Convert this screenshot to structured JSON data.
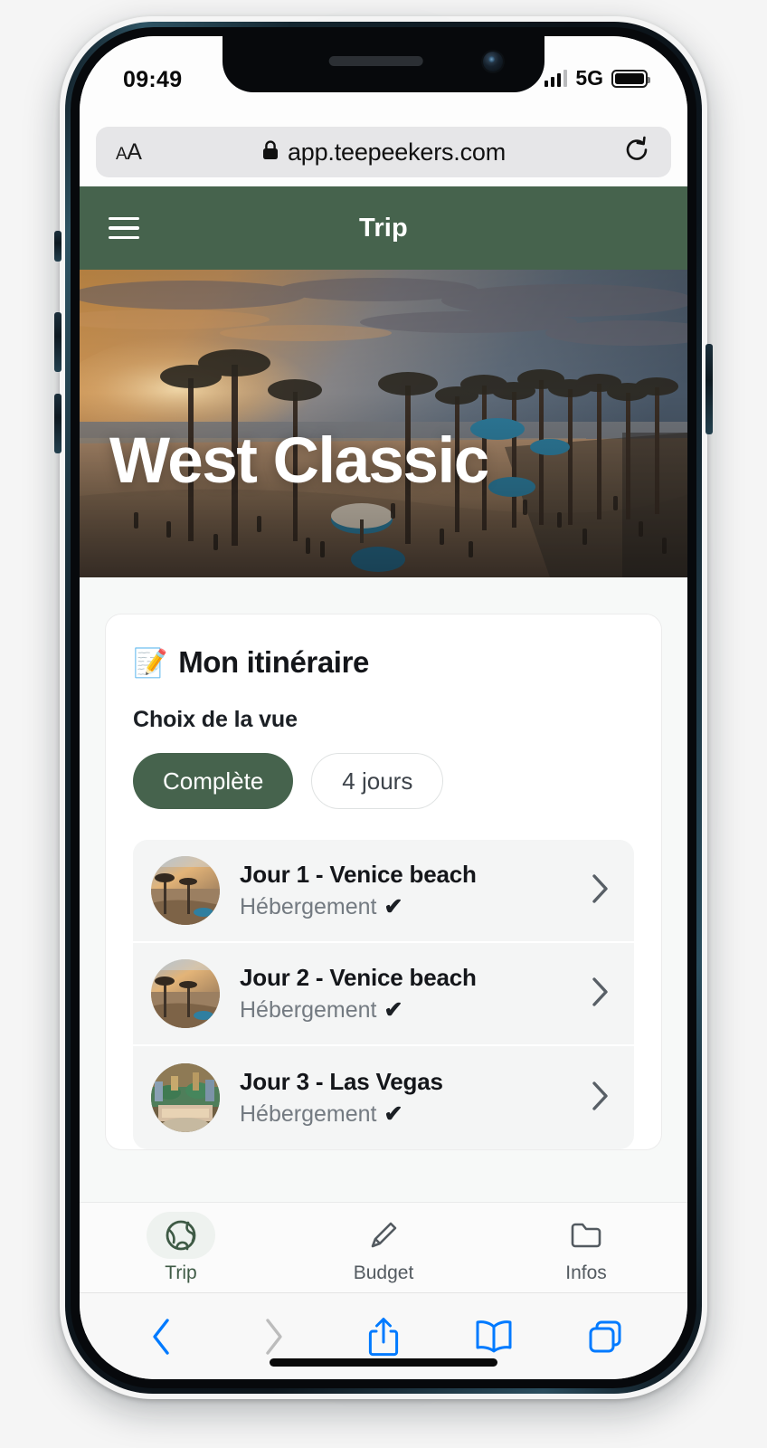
{
  "status_bar": {
    "time": "09:49",
    "network": "5G",
    "signal_icon": "signal-bars-icon",
    "battery_icon": "battery-full-icon"
  },
  "browser": {
    "text_size_button": "AA",
    "lock_icon": "lock-icon",
    "url": "app.teepeekers.com",
    "reload_icon": "reload-icon",
    "toolbar": [
      {
        "name": "back-button",
        "icon": "chevron-left-icon",
        "state": "enabled",
        "color": "#007aff"
      },
      {
        "name": "forward-button",
        "icon": "chevron-right-icon",
        "state": "disabled",
        "color": "#bcbcbc"
      },
      {
        "name": "share-button",
        "icon": "share-icon",
        "state": "enabled",
        "color": "#007aff"
      },
      {
        "name": "bookmarks-button",
        "icon": "book-icon",
        "state": "enabled",
        "color": "#007aff"
      },
      {
        "name": "tabs-button",
        "icon": "tabs-icon",
        "state": "enabled",
        "color": "#007aff"
      }
    ]
  },
  "app_header": {
    "menu_icon": "hamburger-menu-icon",
    "title": "Trip",
    "background_color": "#46634d"
  },
  "hero": {
    "title": "West Classic",
    "image_alt": "venice-beach-sunset"
  },
  "card": {
    "emoji": "📝",
    "title": "Mon itinéraire",
    "view_label": "Choix de la vue",
    "view_options": [
      {
        "label": "Complète",
        "active": true
      },
      {
        "label": "4 jours",
        "active": false
      }
    ],
    "days": [
      {
        "title": "Jour 1 - Venice beach",
        "subtitle": "Hébergement",
        "check": "✔",
        "thumb": "beach-sunset",
        "chevron": "chevron-right-icon"
      },
      {
        "title": "Jour 2 - Venice beach",
        "subtitle": "Hébergement",
        "check": "✔",
        "thumb": "beach-sunset",
        "chevron": "chevron-right-icon"
      },
      {
        "title": "Jour 3 - Las Vegas",
        "subtitle": "Hébergement",
        "check": "✔",
        "thumb": "las-vegas",
        "chevron": "chevron-right-icon"
      }
    ]
  },
  "tabbar": {
    "tabs": [
      {
        "label": "Trip",
        "icon": "globe-icon",
        "active": true
      },
      {
        "label": "Budget",
        "icon": "pencil-icon",
        "active": false
      },
      {
        "label": "Infos",
        "icon": "folder-icon",
        "active": false
      }
    ],
    "active_color": "#3e5a45"
  },
  "colors": {
    "brand_green": "#46634d",
    "page_background": "#f7f9f8",
    "row_background": "#f4f5f5",
    "safari_blue": "#007aff"
  }
}
